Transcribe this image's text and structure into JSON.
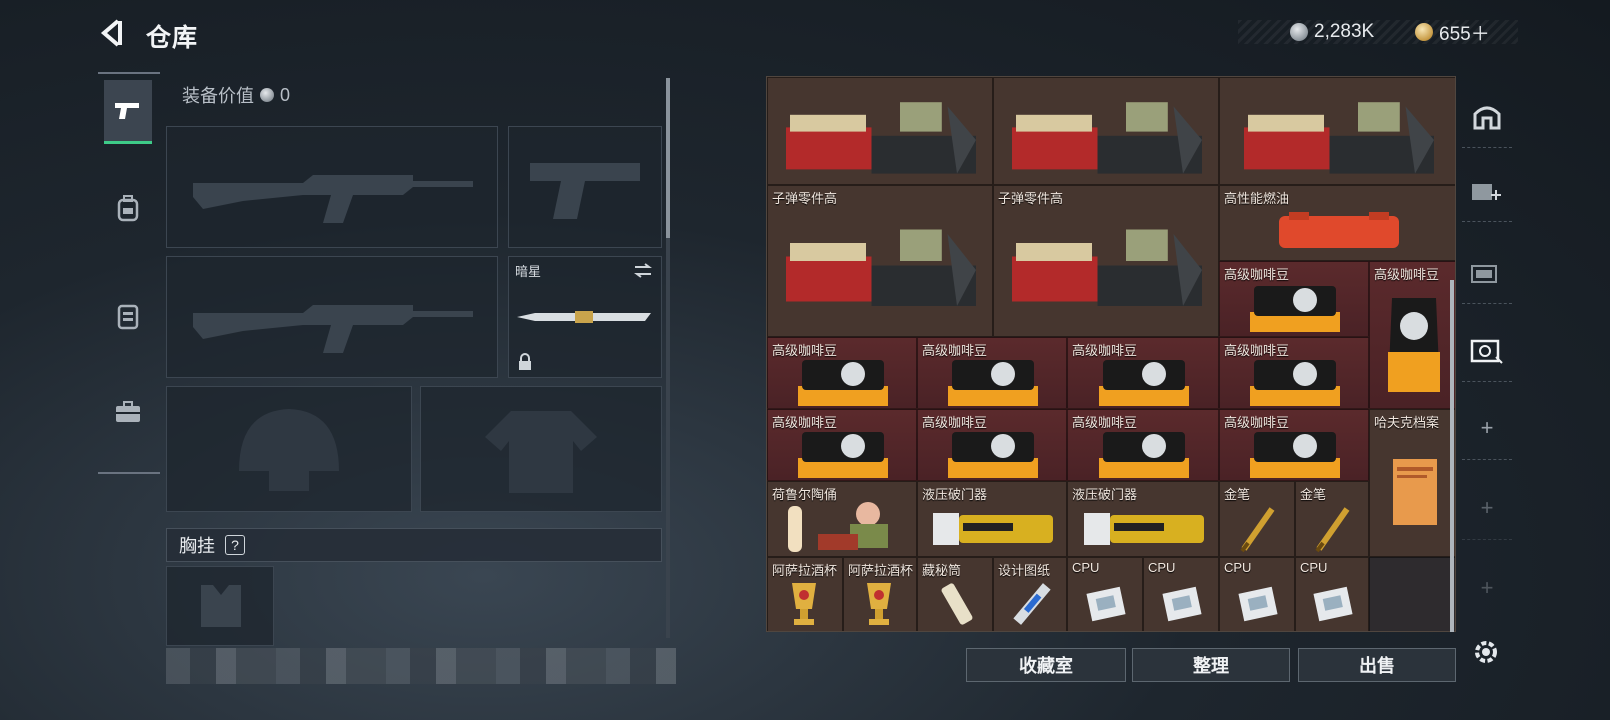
{
  "header": {
    "title": "仓库",
    "currency_silver": "2,283K",
    "currency_gold": "655＋"
  },
  "left_nav": {
    "items": [
      {
        "name": "weapons",
        "icon": "pistol-icon"
      },
      {
        "name": "backpack",
        "icon": "backpack-icon"
      },
      {
        "name": "gear",
        "icon": "vest-icon"
      },
      {
        "name": "case",
        "icon": "toolcase-icon"
      }
    ]
  },
  "equipment": {
    "value_label": "装备价值",
    "value_amount": "0",
    "melee_label": "暗星",
    "chest_rig_label": "胸挂",
    "chest_rig_help": "?"
  },
  "inventory": {
    "items": [
      {
        "label": "",
        "type": "ammo-parts"
      },
      {
        "label": "",
        "type": "ammo-parts"
      },
      {
        "label": "",
        "type": "ammo-parts"
      },
      {
        "label": "子弹零件高",
        "type": "ammo-parts"
      },
      {
        "label": "子弹零件高",
        "type": "ammo-parts"
      },
      {
        "label": "高性能燃油",
        "type": "fuel"
      },
      {
        "label": "高级咖啡豆",
        "type": "coffee"
      },
      {
        "label": "高级咖啡豆",
        "type": "coffee-bag"
      },
      {
        "label": "高级咖啡豆",
        "type": "coffee"
      },
      {
        "label": "高级咖啡豆",
        "type": "coffee"
      },
      {
        "label": "高级咖啡豆",
        "type": "coffee"
      },
      {
        "label": "高级咖啡豆",
        "type": "coffee"
      },
      {
        "label": "高级咖啡豆",
        "type": "coffee"
      },
      {
        "label": "高级咖啡豆",
        "type": "coffee"
      },
      {
        "label": "高级咖啡豆",
        "type": "coffee"
      },
      {
        "label": "高级咖啡豆",
        "type": "coffee"
      },
      {
        "label": "哈夫克档案",
        "type": "dossier"
      },
      {
        "label": "荷鲁尔陶俑",
        "type": "figurine"
      },
      {
        "label": "液压破门器",
        "type": "breacher"
      },
      {
        "label": "液压破门器",
        "type": "breacher"
      },
      {
        "label": "金笔",
        "type": "pen"
      },
      {
        "label": "金笔",
        "type": "pen"
      },
      {
        "label": "阿萨拉酒杯",
        "type": "cup"
      },
      {
        "label": "阿萨拉酒杯",
        "type": "cup"
      },
      {
        "label": "藏秘筒",
        "type": "scroll"
      },
      {
        "label": "设计图纸",
        "type": "blueprint"
      },
      {
        "label": "CPU",
        "type": "cpu"
      },
      {
        "label": "CPU",
        "type": "cpu"
      },
      {
        "label": "CPU",
        "type": "cpu"
      },
      {
        "label": "CPU",
        "type": "cpu"
      }
    ]
  },
  "actions": {
    "collection": "收藏室",
    "sort": "整理",
    "sell": "出售"
  }
}
